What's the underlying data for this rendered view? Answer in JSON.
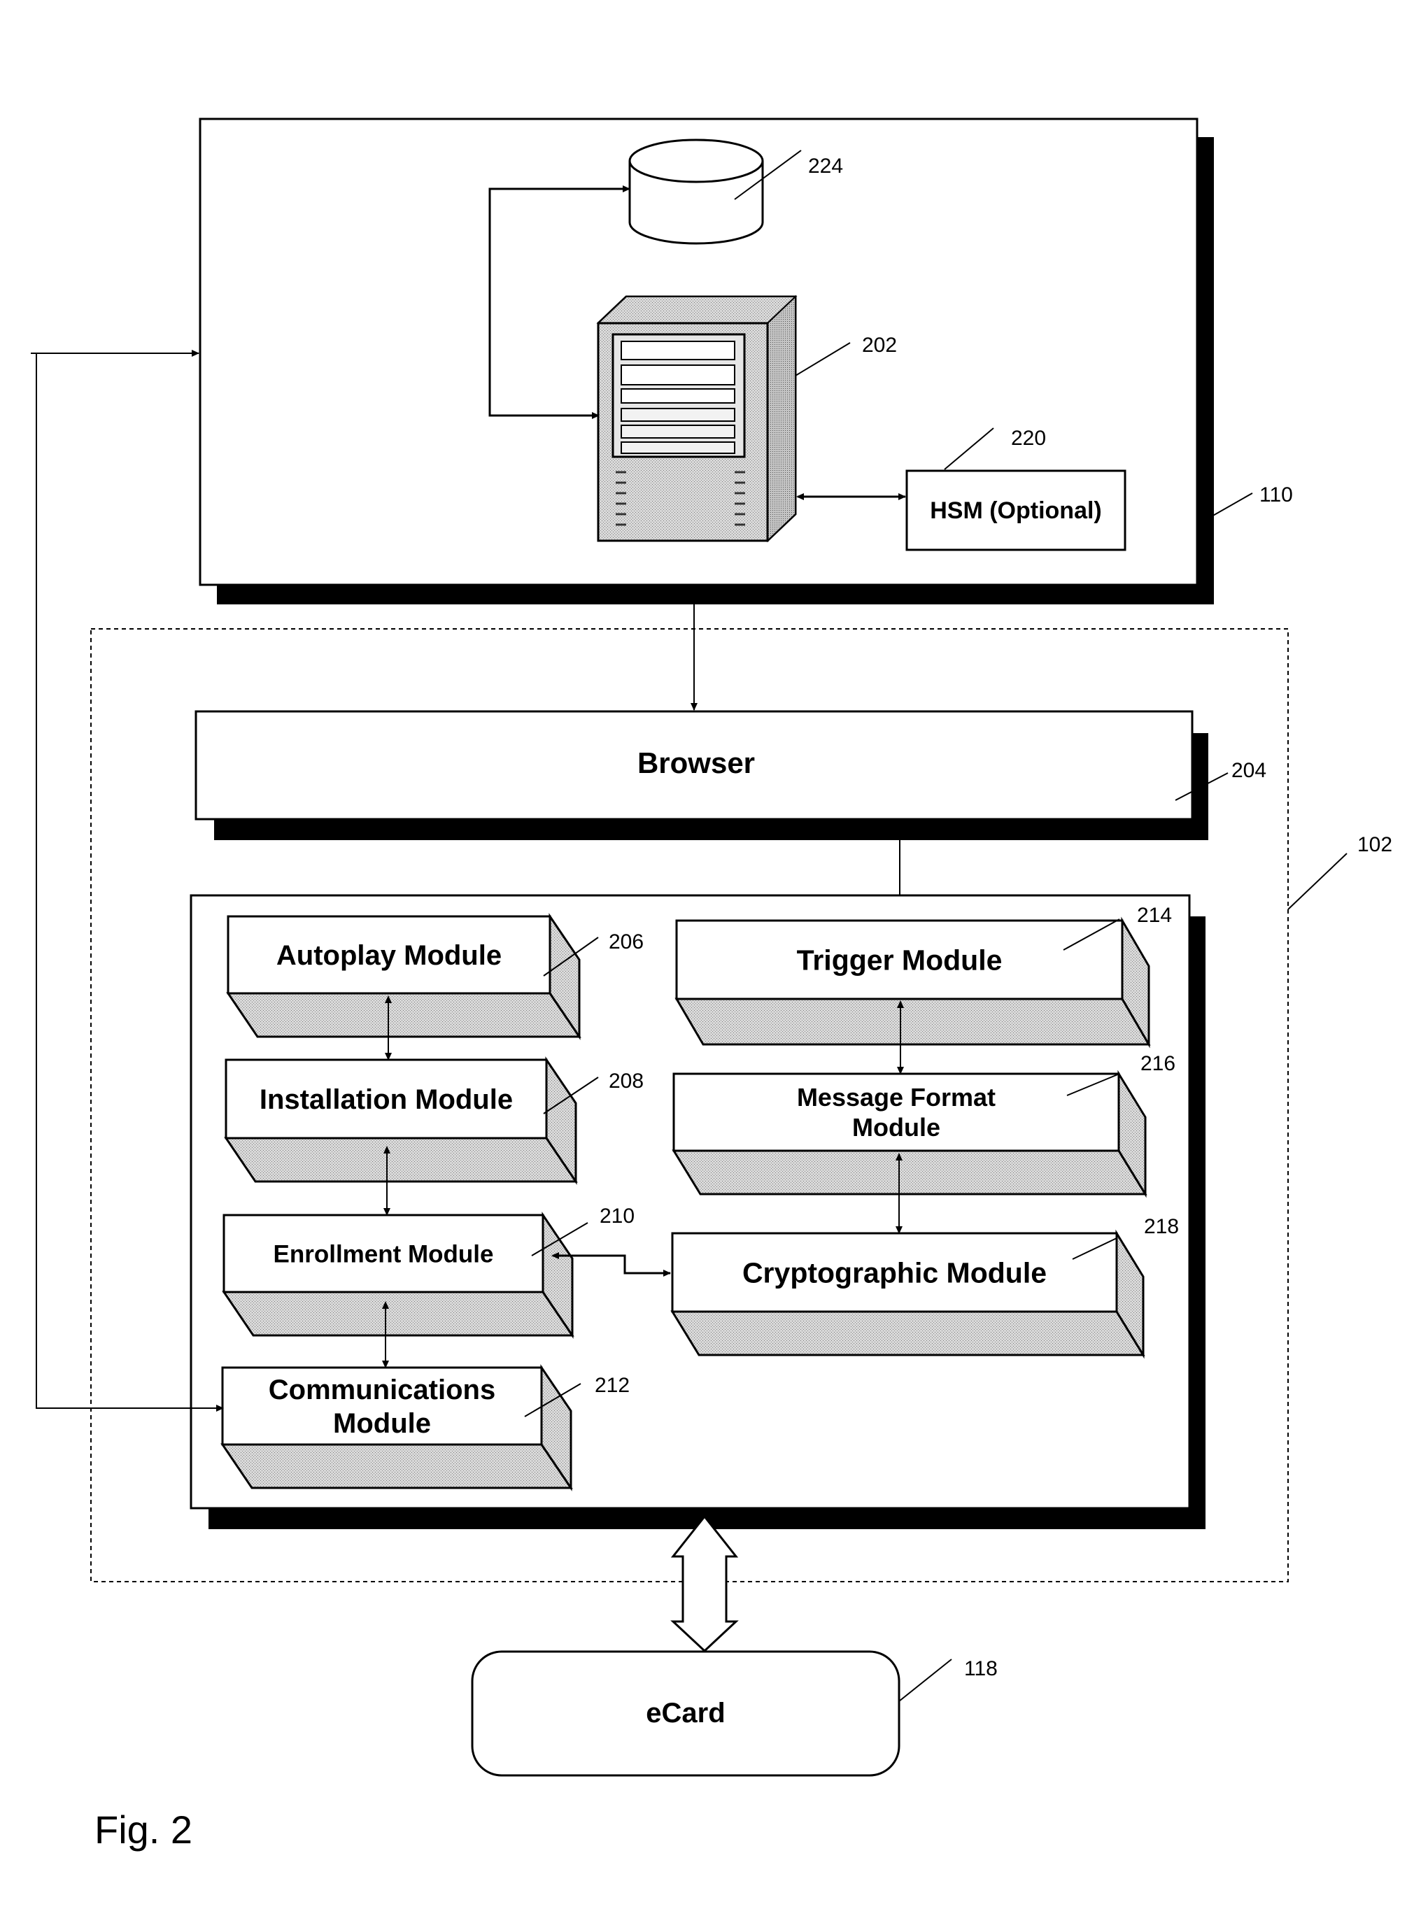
{
  "figure": {
    "caption": "Fig. 2",
    "kind": "patent block diagram"
  },
  "server_system": {
    "ref": "110",
    "database": {
      "ref": "224",
      "icon": "database-cylinder-icon"
    },
    "server": {
      "ref": "202",
      "icon": "server-tower-icon"
    },
    "hsm": {
      "label": "HSM (Optional)",
      "ref": "220"
    }
  },
  "client_device": {
    "ref": "102",
    "browser": {
      "label": "Browser",
      "ref": "204"
    },
    "modules": [
      {
        "id": "autoplay",
        "label_lines": [
          "Autoplay Module"
        ],
        "ref": "206"
      },
      {
        "id": "installation",
        "label_lines": [
          "Installation Module"
        ],
        "ref": "208"
      },
      {
        "id": "enrollment",
        "label_lines": [
          "Enrollment Module"
        ],
        "ref": "210"
      },
      {
        "id": "communications",
        "label_lines": [
          "Communications",
          "Module"
        ],
        "ref": "212"
      },
      {
        "id": "trigger",
        "label_lines": [
          "Trigger Module"
        ],
        "ref": "214"
      },
      {
        "id": "message-format",
        "label_lines": [
          "Message Format",
          "Module"
        ],
        "ref": "216"
      },
      {
        "id": "cryptographic",
        "label_lines": [
          "Cryptographic Module"
        ],
        "ref": "218"
      }
    ]
  },
  "ecard": {
    "label": "eCard",
    "ref": "118"
  },
  "connections": [
    {
      "from": "server",
      "to": "database",
      "type": "arrow"
    },
    {
      "from": "server",
      "to": "hsm",
      "type": "bidirectional"
    },
    {
      "from": "server_system",
      "to": "browser",
      "type": "arrow"
    },
    {
      "from": "browser",
      "to": "trigger",
      "type": "arrow"
    },
    {
      "from": "autoplay",
      "to": "installation",
      "type": "bidirectional"
    },
    {
      "from": "installation",
      "to": "enrollment",
      "type": "bidirectional"
    },
    {
      "from": "enrollment",
      "to": "communications",
      "type": "bidirectional"
    },
    {
      "from": "trigger",
      "to": "message-format",
      "type": "bidirectional"
    },
    {
      "from": "message-format",
      "to": "cryptographic",
      "type": "bidirectional"
    },
    {
      "from": "enrollment",
      "to": "cryptographic",
      "type": "bidirectional"
    },
    {
      "from": "communications",
      "to": "server_system",
      "type": "bidirectional"
    },
    {
      "from": "client_device",
      "to": "ecard",
      "type": "wide-bidirectional"
    }
  ]
}
